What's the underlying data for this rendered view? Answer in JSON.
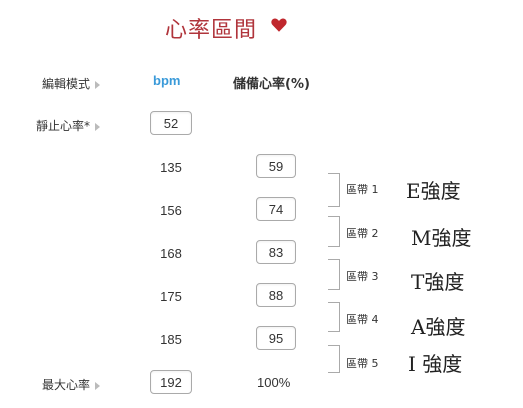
{
  "header": {
    "title": "心率區間",
    "heart_color": "#c0272d",
    "icon": "heart-icon"
  },
  "labels": {
    "edit_mode": "編輯模式",
    "resting_hr": "靜止心率*",
    "max_hr": "最大心率"
  },
  "columns": {
    "bpm": "bpm",
    "reserve": "儲備心率(%)"
  },
  "resting_bpm": "52",
  "max_bpm": "192",
  "max_pct": "100%",
  "rows": [
    {
      "bpm": "135",
      "pct": "59"
    },
    {
      "bpm": "156",
      "pct": "74"
    },
    {
      "bpm": "168",
      "pct": "83"
    },
    {
      "bpm": "175",
      "pct": "88"
    },
    {
      "bpm": "185",
      "pct": "95"
    }
  ],
  "zones": [
    {
      "label": "區帶 1",
      "intensity": "E強度"
    },
    {
      "label": "區帶 2",
      "intensity": "M強度"
    },
    {
      "label": "區帶 3",
      "intensity": "T強度"
    },
    {
      "label": "區帶 4",
      "intensity": "A強度"
    },
    {
      "label": "區帶 5",
      "intensity": "I 強度"
    }
  ]
}
